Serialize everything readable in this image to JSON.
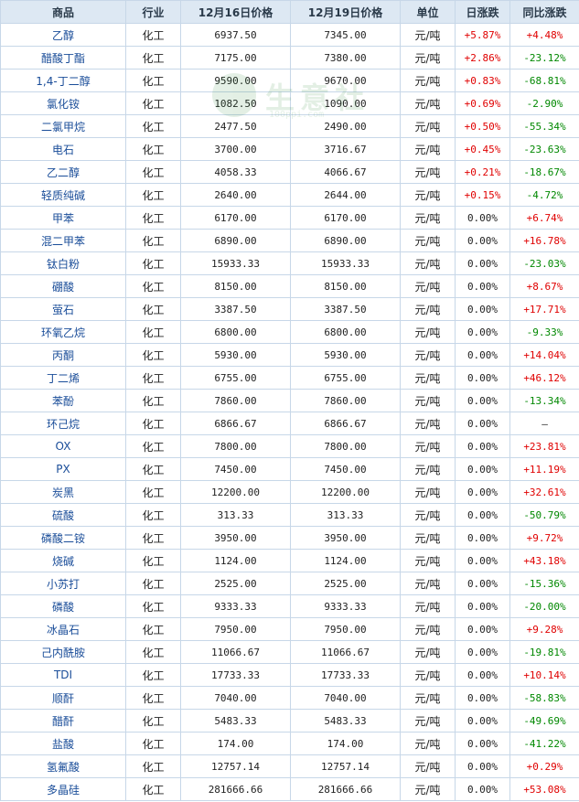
{
  "headers": [
    "商品",
    "行业",
    "12月16日价格",
    "12月19日价格",
    "单位",
    "日涨跌",
    "同比涨跌"
  ],
  "watermark": {
    "text": "生意社",
    "url": "100ppi.com"
  },
  "rows": [
    {
      "name": "乙醇",
      "industry": "化工",
      "p1": "6937.50",
      "p2": "7345.00",
      "unit": "元/吨",
      "daily": "+5.87%",
      "yoy": "+4.48%",
      "dclass": "up",
      "yclass": "up"
    },
    {
      "name": "醋酸丁酯",
      "industry": "化工",
      "p1": "7175.00",
      "p2": "7380.00",
      "unit": "元/吨",
      "daily": "+2.86%",
      "yoy": "-23.12%",
      "dclass": "up",
      "yclass": "down"
    },
    {
      "name": "1,4-丁二醇",
      "industry": "化工",
      "p1": "9590.00",
      "p2": "9670.00",
      "unit": "元/吨",
      "daily": "+0.83%",
      "yoy": "-68.81%",
      "dclass": "up",
      "yclass": "down"
    },
    {
      "name": "氯化铵",
      "industry": "化工",
      "p1": "1082.50",
      "p2": "1090.00",
      "unit": "元/吨",
      "daily": "+0.69%",
      "yoy": "-2.90%",
      "dclass": "up",
      "yclass": "down"
    },
    {
      "name": "二氯甲烷",
      "industry": "化工",
      "p1": "2477.50",
      "p2": "2490.00",
      "unit": "元/吨",
      "daily": "+0.50%",
      "yoy": "-55.34%",
      "dclass": "up",
      "yclass": "down"
    },
    {
      "name": "电石",
      "industry": "化工",
      "p1": "3700.00",
      "p2": "3716.67",
      "unit": "元/吨",
      "daily": "+0.45%",
      "yoy": "-23.63%",
      "dclass": "up",
      "yclass": "down"
    },
    {
      "name": "乙二醇",
      "industry": "化工",
      "p1": "4058.33",
      "p2": "4066.67",
      "unit": "元/吨",
      "daily": "+0.21%",
      "yoy": "-18.67%",
      "dclass": "up",
      "yclass": "down"
    },
    {
      "name": "轻质纯碱",
      "industry": "化工",
      "p1": "2640.00",
      "p2": "2644.00",
      "unit": "元/吨",
      "daily": "+0.15%",
      "yoy": "-4.72%",
      "dclass": "up",
      "yclass": "down"
    },
    {
      "name": "甲苯",
      "industry": "化工",
      "p1": "6170.00",
      "p2": "6170.00",
      "unit": "元/吨",
      "daily": "0.00%",
      "yoy": "+6.74%",
      "dclass": "flat",
      "yclass": "up"
    },
    {
      "name": "混二甲苯",
      "industry": "化工",
      "p1": "6890.00",
      "p2": "6890.00",
      "unit": "元/吨",
      "daily": "0.00%",
      "yoy": "+16.78%",
      "dclass": "flat",
      "yclass": "up"
    },
    {
      "name": "钛白粉",
      "industry": "化工",
      "p1": "15933.33",
      "p2": "15933.33",
      "unit": "元/吨",
      "daily": "0.00%",
      "yoy": "-23.03%",
      "dclass": "flat",
      "yclass": "down"
    },
    {
      "name": "硼酸",
      "industry": "化工",
      "p1": "8150.00",
      "p2": "8150.00",
      "unit": "元/吨",
      "daily": "0.00%",
      "yoy": "+8.67%",
      "dclass": "flat",
      "yclass": "up"
    },
    {
      "name": "萤石",
      "industry": "化工",
      "p1": "3387.50",
      "p2": "3387.50",
      "unit": "元/吨",
      "daily": "0.00%",
      "yoy": "+17.71%",
      "dclass": "flat",
      "yclass": "up"
    },
    {
      "name": "环氧乙烷",
      "industry": "化工",
      "p1": "6800.00",
      "p2": "6800.00",
      "unit": "元/吨",
      "daily": "0.00%",
      "yoy": "-9.33%",
      "dclass": "flat",
      "yclass": "down"
    },
    {
      "name": "丙酮",
      "industry": "化工",
      "p1": "5930.00",
      "p2": "5930.00",
      "unit": "元/吨",
      "daily": "0.00%",
      "yoy": "+14.04%",
      "dclass": "flat",
      "yclass": "up"
    },
    {
      "name": "丁二烯",
      "industry": "化工",
      "p1": "6755.00",
      "p2": "6755.00",
      "unit": "元/吨",
      "daily": "0.00%",
      "yoy": "+46.12%",
      "dclass": "flat",
      "yclass": "up"
    },
    {
      "name": "苯酚",
      "industry": "化工",
      "p1": "7860.00",
      "p2": "7860.00",
      "unit": "元/吨",
      "daily": "0.00%",
      "yoy": "-13.34%",
      "dclass": "flat",
      "yclass": "down"
    },
    {
      "name": "环己烷",
      "industry": "化工",
      "p1": "6866.67",
      "p2": "6866.67",
      "unit": "元/吨",
      "daily": "0.00%",
      "yoy": "—",
      "dclass": "flat",
      "yclass": "flat"
    },
    {
      "name": "OX",
      "industry": "化工",
      "p1": "7800.00",
      "p2": "7800.00",
      "unit": "元/吨",
      "daily": "0.00%",
      "yoy": "+23.81%",
      "dclass": "flat",
      "yclass": "up"
    },
    {
      "name": "PX",
      "industry": "化工",
      "p1": "7450.00",
      "p2": "7450.00",
      "unit": "元/吨",
      "daily": "0.00%",
      "yoy": "+11.19%",
      "dclass": "flat",
      "yclass": "up"
    },
    {
      "name": "炭黑",
      "industry": "化工",
      "p1": "12200.00",
      "p2": "12200.00",
      "unit": "元/吨",
      "daily": "0.00%",
      "yoy": "+32.61%",
      "dclass": "flat",
      "yclass": "up"
    },
    {
      "name": "硫酸",
      "industry": "化工",
      "p1": "313.33",
      "p2": "313.33",
      "unit": "元/吨",
      "daily": "0.00%",
      "yoy": "-50.79%",
      "dclass": "flat",
      "yclass": "down"
    },
    {
      "name": "磷酸二铵",
      "industry": "化工",
      "p1": "3950.00",
      "p2": "3950.00",
      "unit": "元/吨",
      "daily": "0.00%",
      "yoy": "+9.72%",
      "dclass": "flat",
      "yclass": "up"
    },
    {
      "name": "烧碱",
      "industry": "化工",
      "p1": "1124.00",
      "p2": "1124.00",
      "unit": "元/吨",
      "daily": "0.00%",
      "yoy": "+43.18%",
      "dclass": "flat",
      "yclass": "up"
    },
    {
      "name": "小苏打",
      "industry": "化工",
      "p1": "2525.00",
      "p2": "2525.00",
      "unit": "元/吨",
      "daily": "0.00%",
      "yoy": "-15.36%",
      "dclass": "flat",
      "yclass": "down"
    },
    {
      "name": "磷酸",
      "industry": "化工",
      "p1": "9333.33",
      "p2": "9333.33",
      "unit": "元/吨",
      "daily": "0.00%",
      "yoy": "-20.00%",
      "dclass": "flat",
      "yclass": "down"
    },
    {
      "name": "冰晶石",
      "industry": "化工",
      "p1": "7950.00",
      "p2": "7950.00",
      "unit": "元/吨",
      "daily": "0.00%",
      "yoy": "+9.28%",
      "dclass": "flat",
      "yclass": "up"
    },
    {
      "name": "己内酰胺",
      "industry": "化工",
      "p1": "11066.67",
      "p2": "11066.67",
      "unit": "元/吨",
      "daily": "0.00%",
      "yoy": "-19.81%",
      "dclass": "flat",
      "yclass": "down"
    },
    {
      "name": "TDI",
      "industry": "化工",
      "p1": "17733.33",
      "p2": "17733.33",
      "unit": "元/吨",
      "daily": "0.00%",
      "yoy": "+10.14%",
      "dclass": "flat",
      "yclass": "up"
    },
    {
      "name": "顺酐",
      "industry": "化工",
      "p1": "7040.00",
      "p2": "7040.00",
      "unit": "元/吨",
      "daily": "0.00%",
      "yoy": "-58.83%",
      "dclass": "flat",
      "yclass": "down"
    },
    {
      "name": "醋酐",
      "industry": "化工",
      "p1": "5483.33",
      "p2": "5483.33",
      "unit": "元/吨",
      "daily": "0.00%",
      "yoy": "-49.69%",
      "dclass": "flat",
      "yclass": "down"
    },
    {
      "name": "盐酸",
      "industry": "化工",
      "p1": "174.00",
      "p2": "174.00",
      "unit": "元/吨",
      "daily": "0.00%",
      "yoy": "-41.22%",
      "dclass": "flat",
      "yclass": "down"
    },
    {
      "name": "氢氟酸",
      "industry": "化工",
      "p1": "12757.14",
      "p2": "12757.14",
      "unit": "元/吨",
      "daily": "0.00%",
      "yoy": "+0.29%",
      "dclass": "flat",
      "yclass": "up"
    },
    {
      "name": "多晶硅",
      "industry": "化工",
      "p1": "281666.66",
      "p2": "281666.66",
      "unit": "元/吨",
      "daily": "0.00%",
      "yoy": "+53.08%",
      "dclass": "flat",
      "yclass": "up"
    }
  ]
}
